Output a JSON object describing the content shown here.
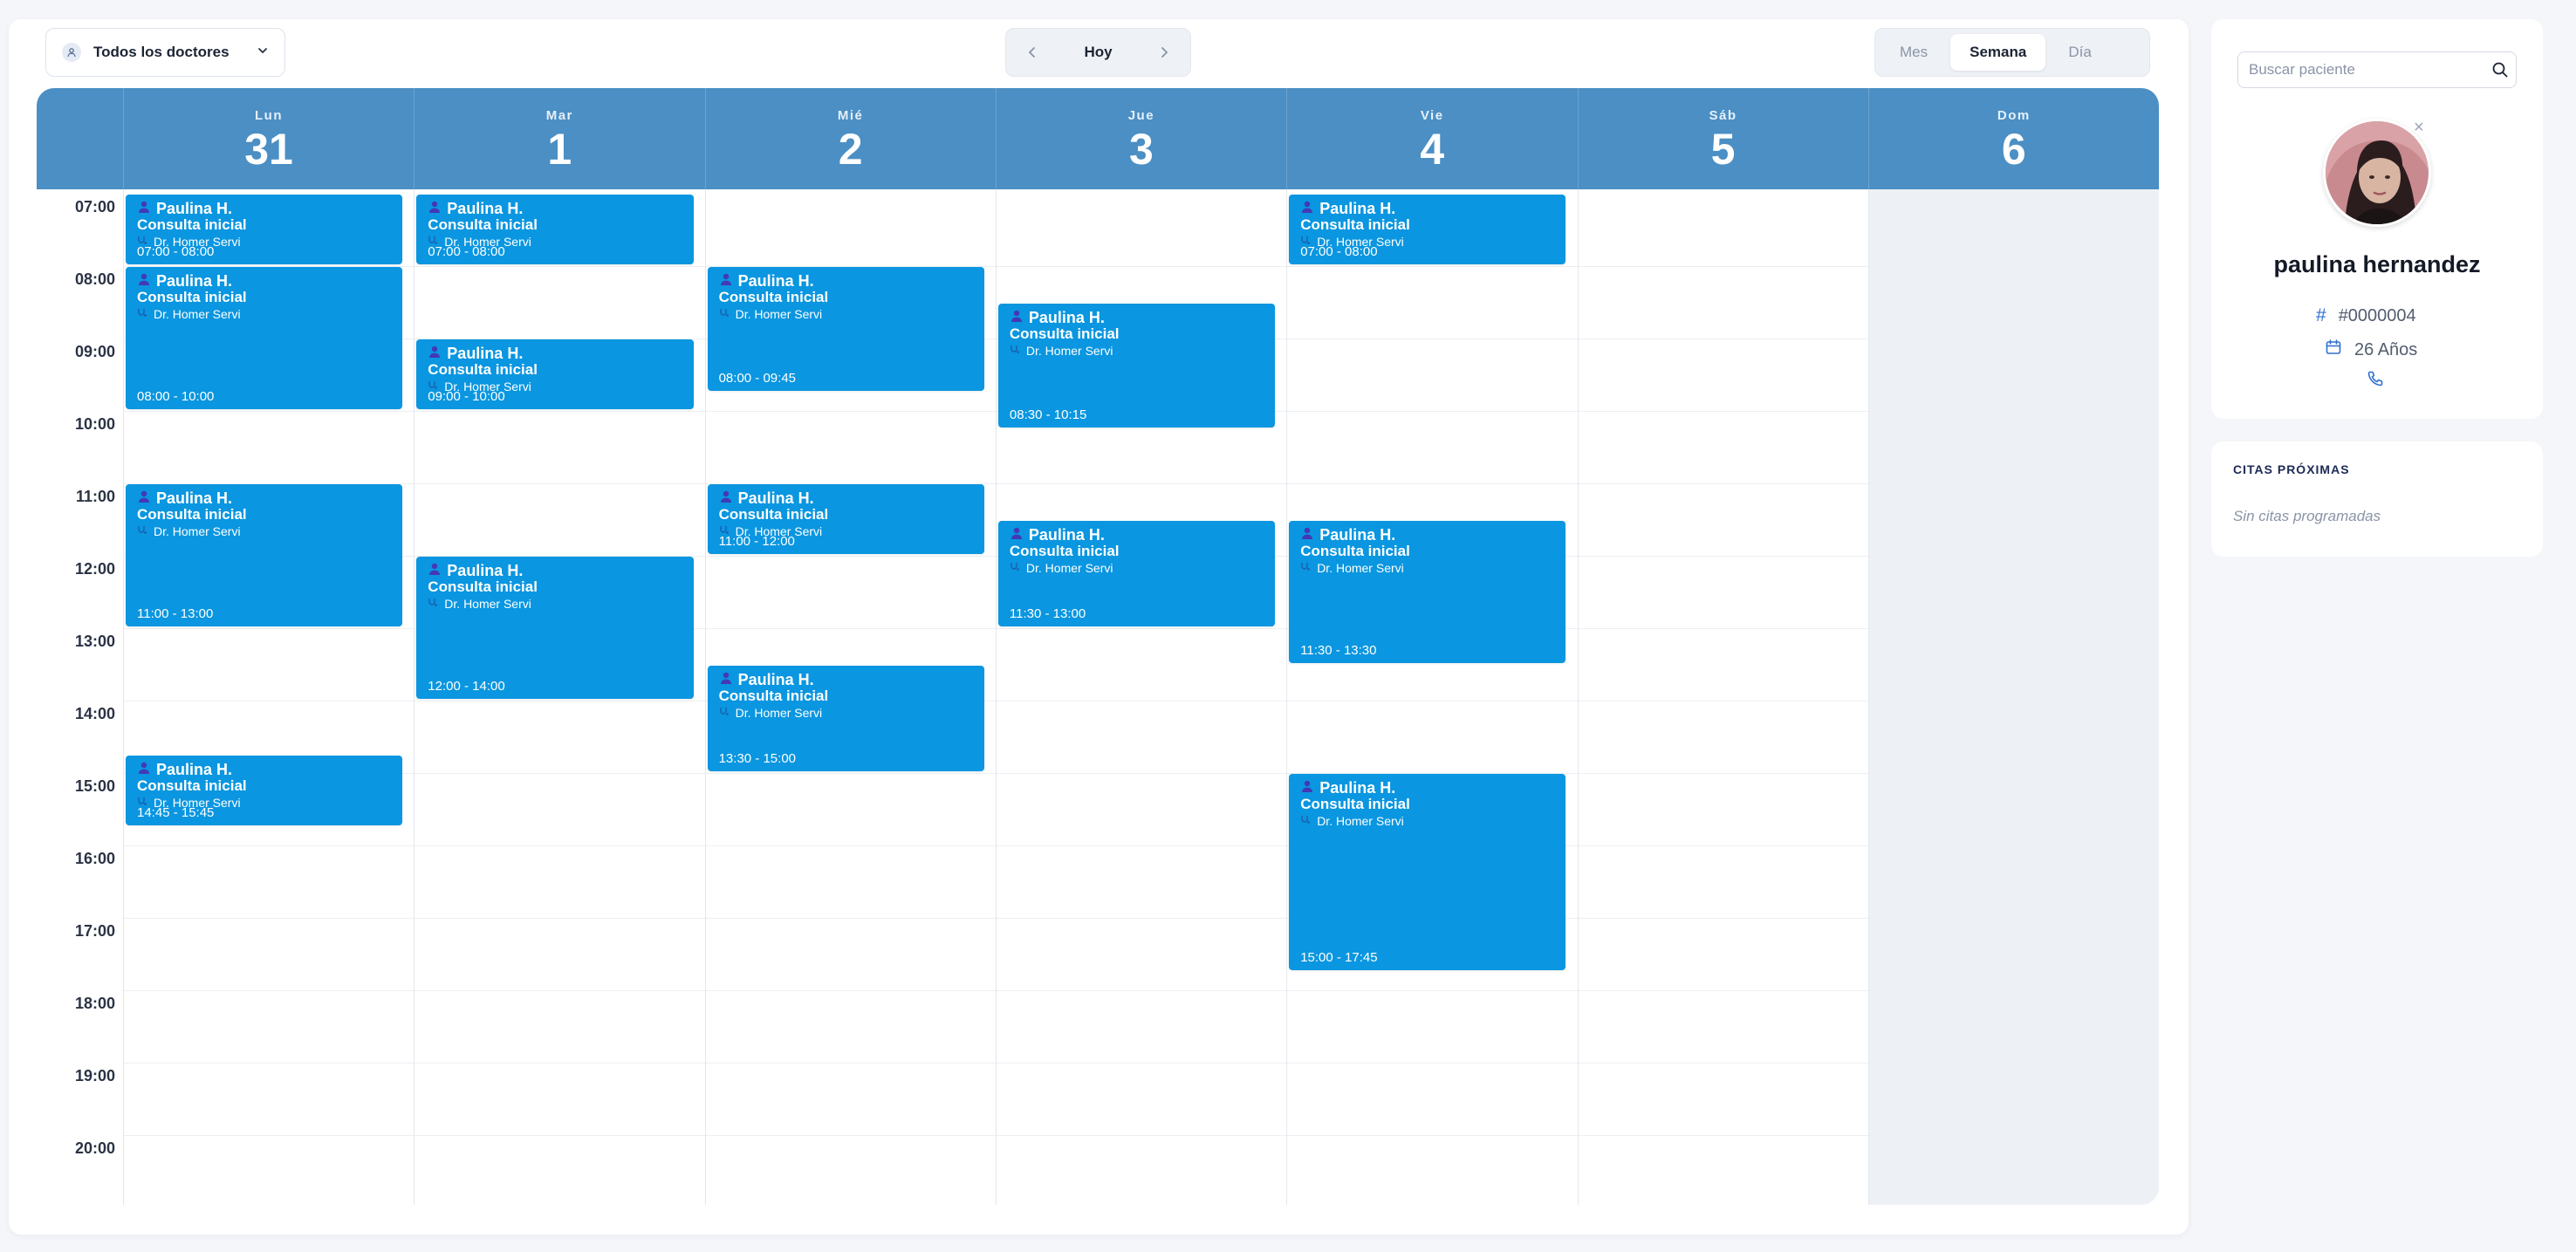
{
  "toolbar": {
    "doctor_filter": "Todos los doctores",
    "today_label": "Hoy",
    "views": [
      "Mes",
      "Semana",
      "Día"
    ],
    "active_view": "Semana"
  },
  "days": [
    {
      "name": "Lun",
      "num": "31"
    },
    {
      "name": "Mar",
      "num": "1"
    },
    {
      "name": "Mié",
      "num": "2"
    },
    {
      "name": "Jue",
      "num": "3"
    },
    {
      "name": "Vie",
      "num": "4"
    },
    {
      "name": "Sáb",
      "num": "5"
    },
    {
      "name": "Dom",
      "num": "6"
    }
  ],
  "hours": [
    "07:00",
    "08:00",
    "09:00",
    "10:00",
    "11:00",
    "12:00",
    "13:00",
    "14:00",
    "15:00",
    "16:00",
    "17:00",
    "18:00",
    "19:00",
    "20:00"
  ],
  "events": [
    {
      "day": 0,
      "start": "07:00",
      "end": "08:00",
      "patient": "Paulina H.",
      "type": "Consulta inicial",
      "doctor": "Dr. Homer Servi",
      "time": "07:00 - 08:00"
    },
    {
      "day": 0,
      "start": "08:00",
      "end": "10:00",
      "patient": "Paulina H.",
      "type": "Consulta inicial",
      "doctor": "Dr. Homer Servi",
      "time": "08:00 - 10:00"
    },
    {
      "day": 0,
      "start": "11:00",
      "end": "13:00",
      "patient": "Paulina H.",
      "type": "Consulta inicial",
      "doctor": "Dr. Homer Servi",
      "time": "11:00 - 13:00"
    },
    {
      "day": 0,
      "start": "14:45",
      "end": "15:45",
      "patient": "Paulina H.",
      "type": "Consulta inicial",
      "doctor": "Dr. Homer Servi",
      "time": "14:45 - 15:45"
    },
    {
      "day": 1,
      "start": "07:00",
      "end": "08:00",
      "patient": "Paulina H.",
      "type": "Consulta inicial",
      "doctor": "Dr. Homer Servi",
      "time": "07:00 - 08:00"
    },
    {
      "day": 1,
      "start": "09:00",
      "end": "10:00",
      "patient": "Paulina H.",
      "type": "Consulta inicial",
      "doctor": "Dr. Homer Servi",
      "time": "09:00 - 10:00"
    },
    {
      "day": 1,
      "start": "12:00",
      "end": "14:00",
      "patient": "Paulina H.",
      "type": "Consulta inicial",
      "doctor": "Dr. Homer Servi",
      "time": "12:00 - 14:00"
    },
    {
      "day": 2,
      "start": "08:00",
      "end": "09:45",
      "patient": "Paulina H.",
      "type": "Consulta inicial",
      "doctor": "Dr. Homer Servi",
      "time": "08:00 - 09:45"
    },
    {
      "day": 2,
      "start": "11:00",
      "end": "12:00",
      "patient": "Paulina H.",
      "type": "Consulta inicial",
      "doctor": "Dr. Homer Servi",
      "time": "11:00 - 12:00"
    },
    {
      "day": 2,
      "start": "13:30",
      "end": "15:00",
      "patient": "Paulina H.",
      "type": "Consulta inicial",
      "doctor": "Dr. Homer Servi",
      "time": "13:30 - 15:00"
    },
    {
      "day": 3,
      "start": "08:30",
      "end": "10:15",
      "patient": "Paulina H.",
      "type": "Consulta inicial",
      "doctor": "Dr. Homer Servi",
      "time": "08:30 - 10:15"
    },
    {
      "day": 3,
      "start": "11:30",
      "end": "13:00",
      "patient": "Paulina H.",
      "type": "Consulta inicial",
      "doctor": "Dr. Homer Servi",
      "time": "11:30 - 13:00"
    },
    {
      "day": 4,
      "start": "07:00",
      "end": "08:00",
      "patient": "Paulina H.",
      "type": "Consulta inicial",
      "doctor": "Dr. Homer Servi",
      "time": "07:00 - 08:00"
    },
    {
      "day": 4,
      "start": "11:30",
      "end": "13:30",
      "patient": "Paulina H.",
      "type": "Consulta inicial",
      "doctor": "Dr. Homer Servi",
      "time": "11:30 - 13:30"
    },
    {
      "day": 4,
      "start": "15:00",
      "end": "17:45",
      "patient": "Paulina H.",
      "type": "Consulta inicial",
      "doctor": "Dr. Homer Servi",
      "time": "15:00 - 17:45"
    }
  ],
  "patient": {
    "search_placeholder": "Buscar paciente",
    "name": "paulina hernandez",
    "id": "#0000004",
    "age": "26 Años"
  },
  "upcoming": {
    "title": "CITAS PRÓXIMAS",
    "empty": "Sin citas programadas"
  },
  "colors": {
    "header": "#4b8fc4",
    "event": "#0a96e0",
    "accent": "#2f6fd1"
  }
}
